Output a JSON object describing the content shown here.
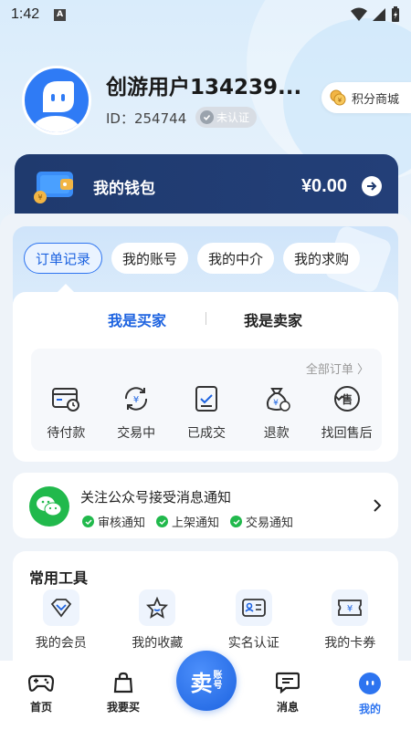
{
  "status_bar": {
    "time": "1:42",
    "notification_letter": "A"
  },
  "profile": {
    "username": "创游用户134239...",
    "uid": "ID：254744",
    "verify_status": "未认证",
    "points_mall": "积分商城"
  },
  "wallet": {
    "label": "我的钱包",
    "amount": "¥0.00"
  },
  "order_tabs": [
    {
      "label": "订单记录",
      "active": true
    },
    {
      "label": "我的账号",
      "active": false
    },
    {
      "label": "我的中介",
      "active": false
    },
    {
      "label": "我的求购",
      "active": false
    }
  ],
  "roles": {
    "buyer": "我是买家",
    "seller": "我是卖家",
    "active": "buyer"
  },
  "orders": {
    "all_link": "全部订单 〉",
    "items": [
      {
        "label": "待付款",
        "icon": "pending-payment-icon"
      },
      {
        "label": "交易中",
        "icon": "trading-icon"
      },
      {
        "label": "已成交",
        "icon": "completed-icon"
      },
      {
        "label": "退款",
        "icon": "refund-icon"
      },
      {
        "label": "找回售后",
        "icon": "after-sale-icon"
      }
    ]
  },
  "notify": {
    "title": "关注公众号接受消息通知",
    "tags": [
      "审核通知",
      "上架通知",
      "交易通知"
    ]
  },
  "tools": {
    "title": "常用工具",
    "items": [
      {
        "label": "我的会员",
        "icon": "diamond-icon"
      },
      {
        "label": "我的收藏",
        "icon": "star-icon"
      },
      {
        "label": "实名认证",
        "icon": "id-card-icon"
      },
      {
        "label": "我的卡券",
        "icon": "coupon-icon"
      }
    ]
  },
  "bottom_nav": {
    "items": [
      {
        "label": "首页",
        "icon": "gamepad-icon"
      },
      {
        "label": "我要买",
        "icon": "bag-icon"
      },
      {
        "label": "消息",
        "icon": "message-icon"
      },
      {
        "label": "我的",
        "icon": "profile-icon",
        "active": true
      }
    ],
    "sell_button": {
      "main": "卖",
      "sub_top": "账",
      "sub_bottom": "号"
    }
  },
  "colors": {
    "accent": "#2d74f0",
    "wallet_bg": "#1f3a6e",
    "wechat_green": "#21b94c"
  }
}
